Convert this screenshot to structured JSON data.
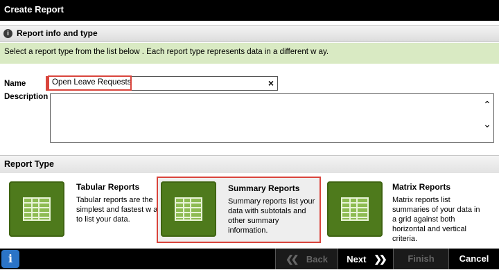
{
  "window": {
    "title": "Create Report"
  },
  "info_section": {
    "title": "Report info and type",
    "hint": "Select a report type from the list below . Each report type represents data in a different w ay."
  },
  "form": {
    "name_label": "Name",
    "name_value": "Open Leave Requests",
    "clear_icon": "×",
    "description_label": "Description",
    "description_value": ""
  },
  "report_type": {
    "heading": "Report Type",
    "options": [
      {
        "title": "Tabular Reports",
        "description": "Tabular reports are the simplest and fastest w ay to list your data."
      },
      {
        "title": "Summary Reports",
        "description": "Summary reports list your data with subtotals and other summary information."
      },
      {
        "title": "Matrix Reports",
        "description": "Matrix reports list summaries of your data in a grid against both horizontal and vertical criteria."
      }
    ],
    "selected": "Summary Reports"
  },
  "footer": {
    "back": "Back",
    "next": "Next",
    "finish": "Finish",
    "cancel": "Cancel"
  },
  "colors": {
    "accent_green": "#4e7a1c",
    "hint_bg": "#d9eac3",
    "highlight_red": "#d9443c",
    "info_blue": "#2b74c7"
  }
}
